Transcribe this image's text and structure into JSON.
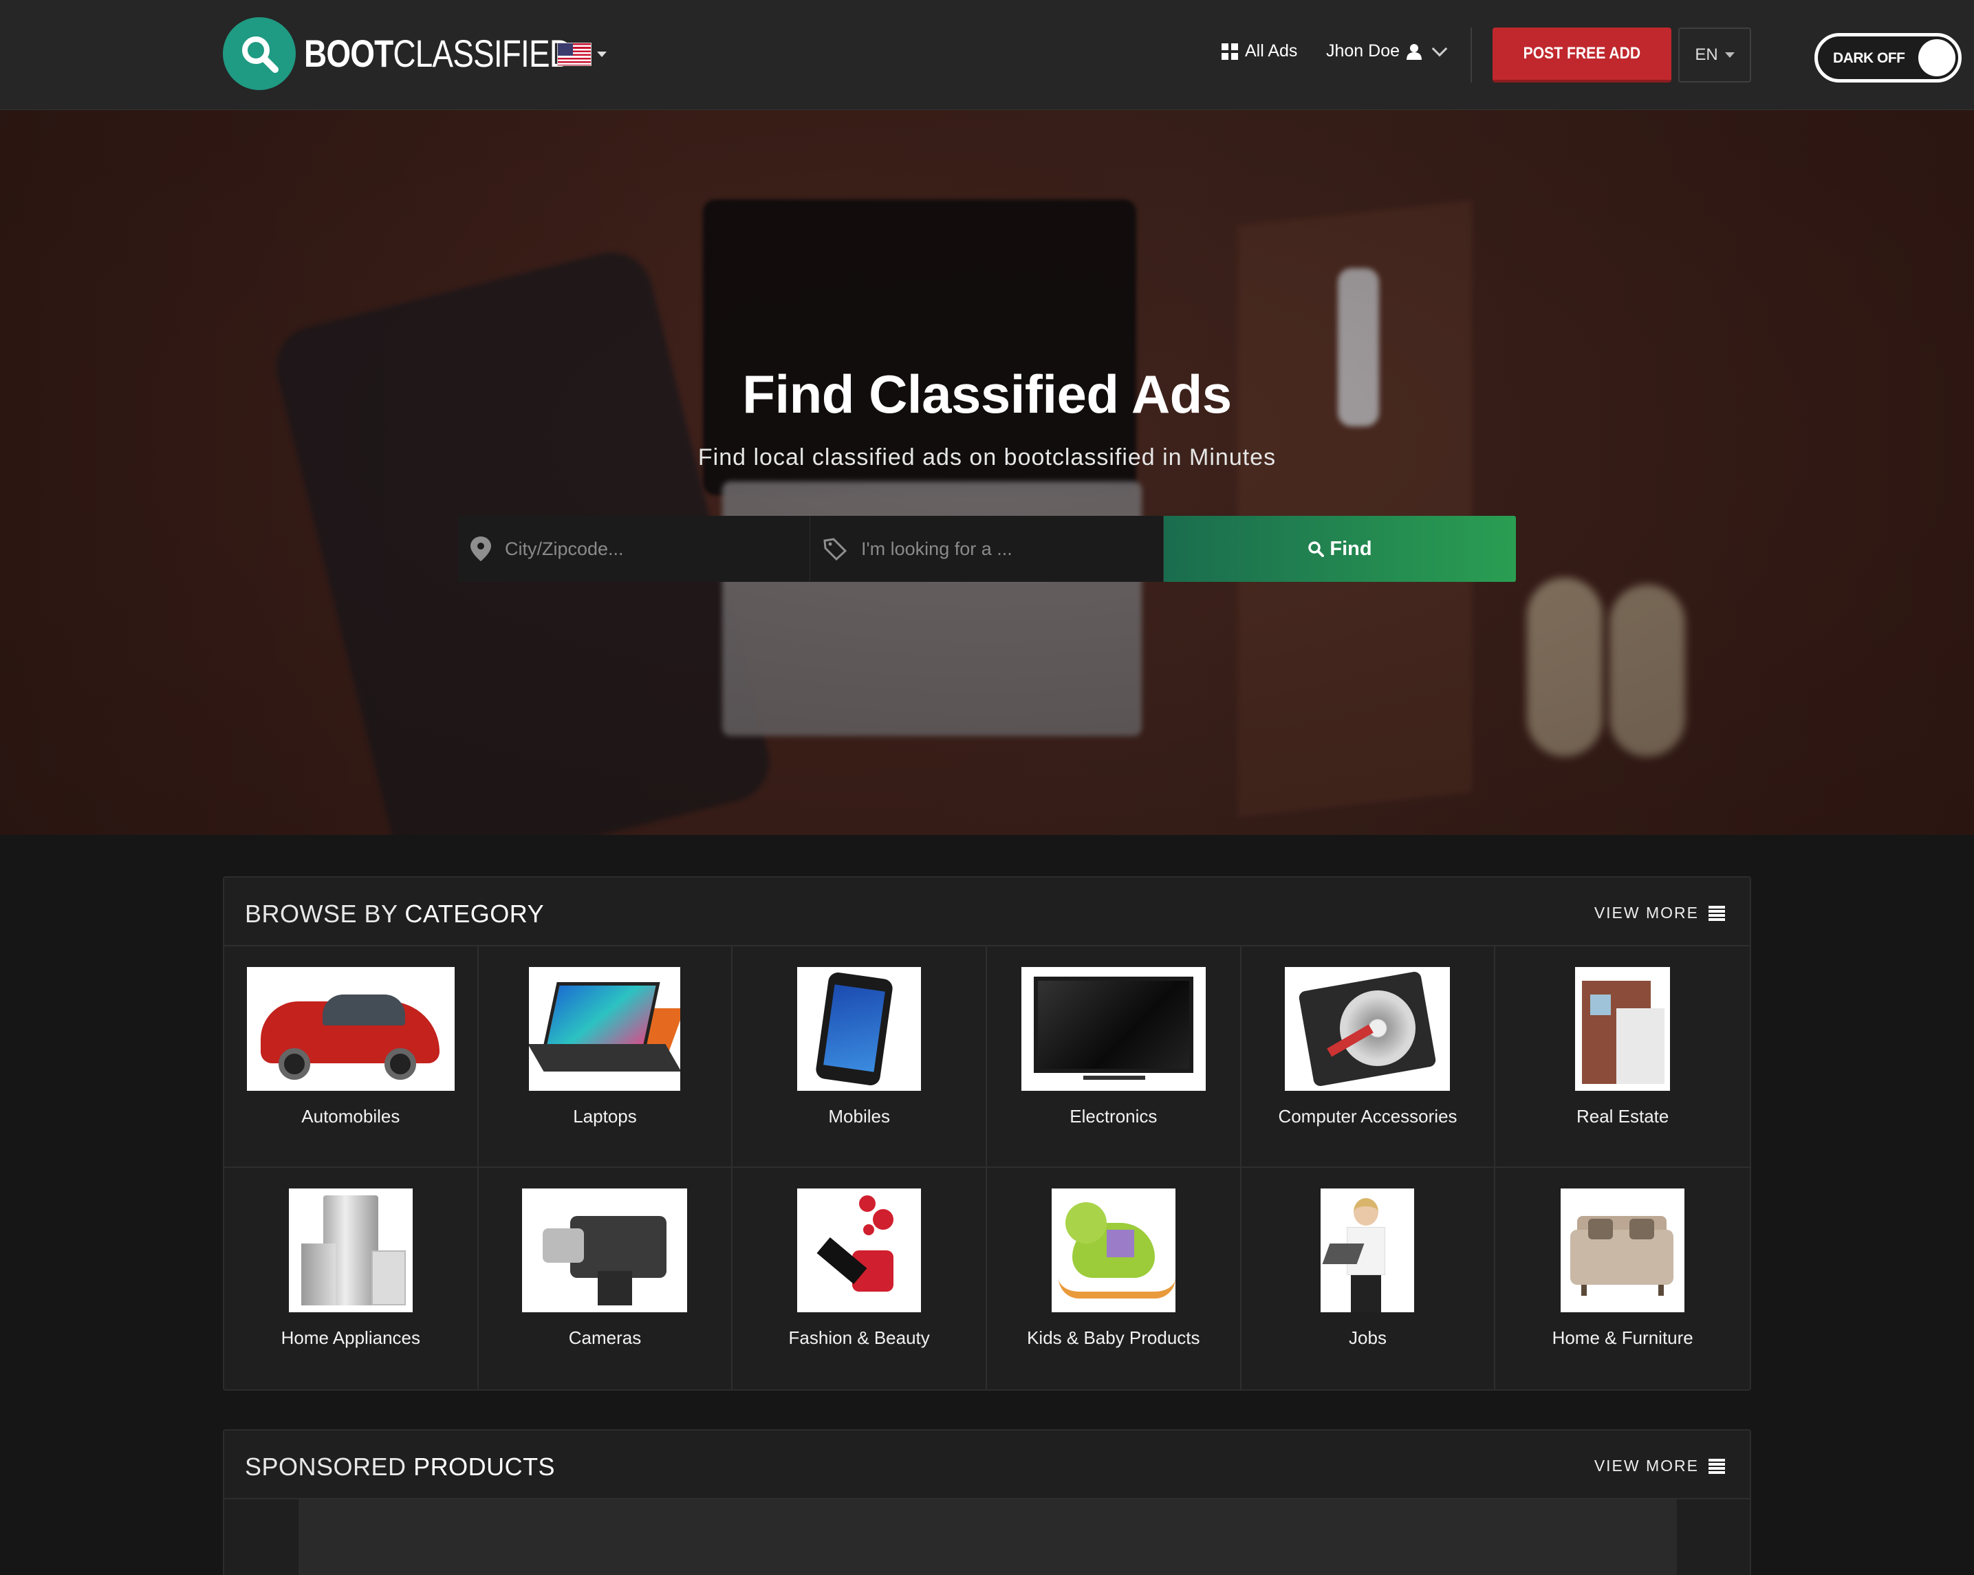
{
  "header": {
    "brand_bold": "BOOT",
    "brand_light": "CLASSIFIED",
    "nav_all_ads": "All Ads",
    "nav_user": "Jhon Doe",
    "post_button": "POST FREE ADD",
    "language": "EN",
    "dark_toggle": "DARK OFF"
  },
  "hero": {
    "title": "Find Classified Ads",
    "subtitle": "Find local classified ads on bootclassified in Minutes",
    "location_placeholder": "City/Zipcode...",
    "keyword_placeholder": "I'm looking for a ...",
    "find_button": "Find"
  },
  "categories_panel": {
    "title_light": "BROWSE BY",
    "title_bold": "CATEGORY",
    "view_more": "VIEW MORE",
    "items": [
      {
        "label": "Automobiles",
        "icon": "car-image"
      },
      {
        "label": "Laptops",
        "icon": "laptop-image"
      },
      {
        "label": "Mobiles",
        "icon": "phone-image"
      },
      {
        "label": "Electronics",
        "icon": "tv-image"
      },
      {
        "label": "Computer Accessories",
        "icon": "hard-drive-image"
      },
      {
        "label": "Real Estate",
        "icon": "house-image"
      },
      {
        "label": "Home Appliances",
        "icon": "appliances-image"
      },
      {
        "label": "Cameras",
        "icon": "camera-image"
      },
      {
        "label": "Fashion & Beauty",
        "icon": "nail-polish-image"
      },
      {
        "label": "Kids & Baby Products",
        "icon": "toy-image"
      },
      {
        "label": "Jobs",
        "icon": "woman-laptop-image"
      },
      {
        "label": "Home & Furniture",
        "icon": "sofa-image"
      }
    ]
  },
  "sponsored_panel": {
    "title_light": "SPONSORED",
    "title_bold": "PRODUCTS",
    "view_more": "VIEW MORE"
  },
  "colors": {
    "accent_green": "#1f9a83",
    "post_red": "#c0282d",
    "find_green": "#2a9e52",
    "background": "#161616"
  }
}
